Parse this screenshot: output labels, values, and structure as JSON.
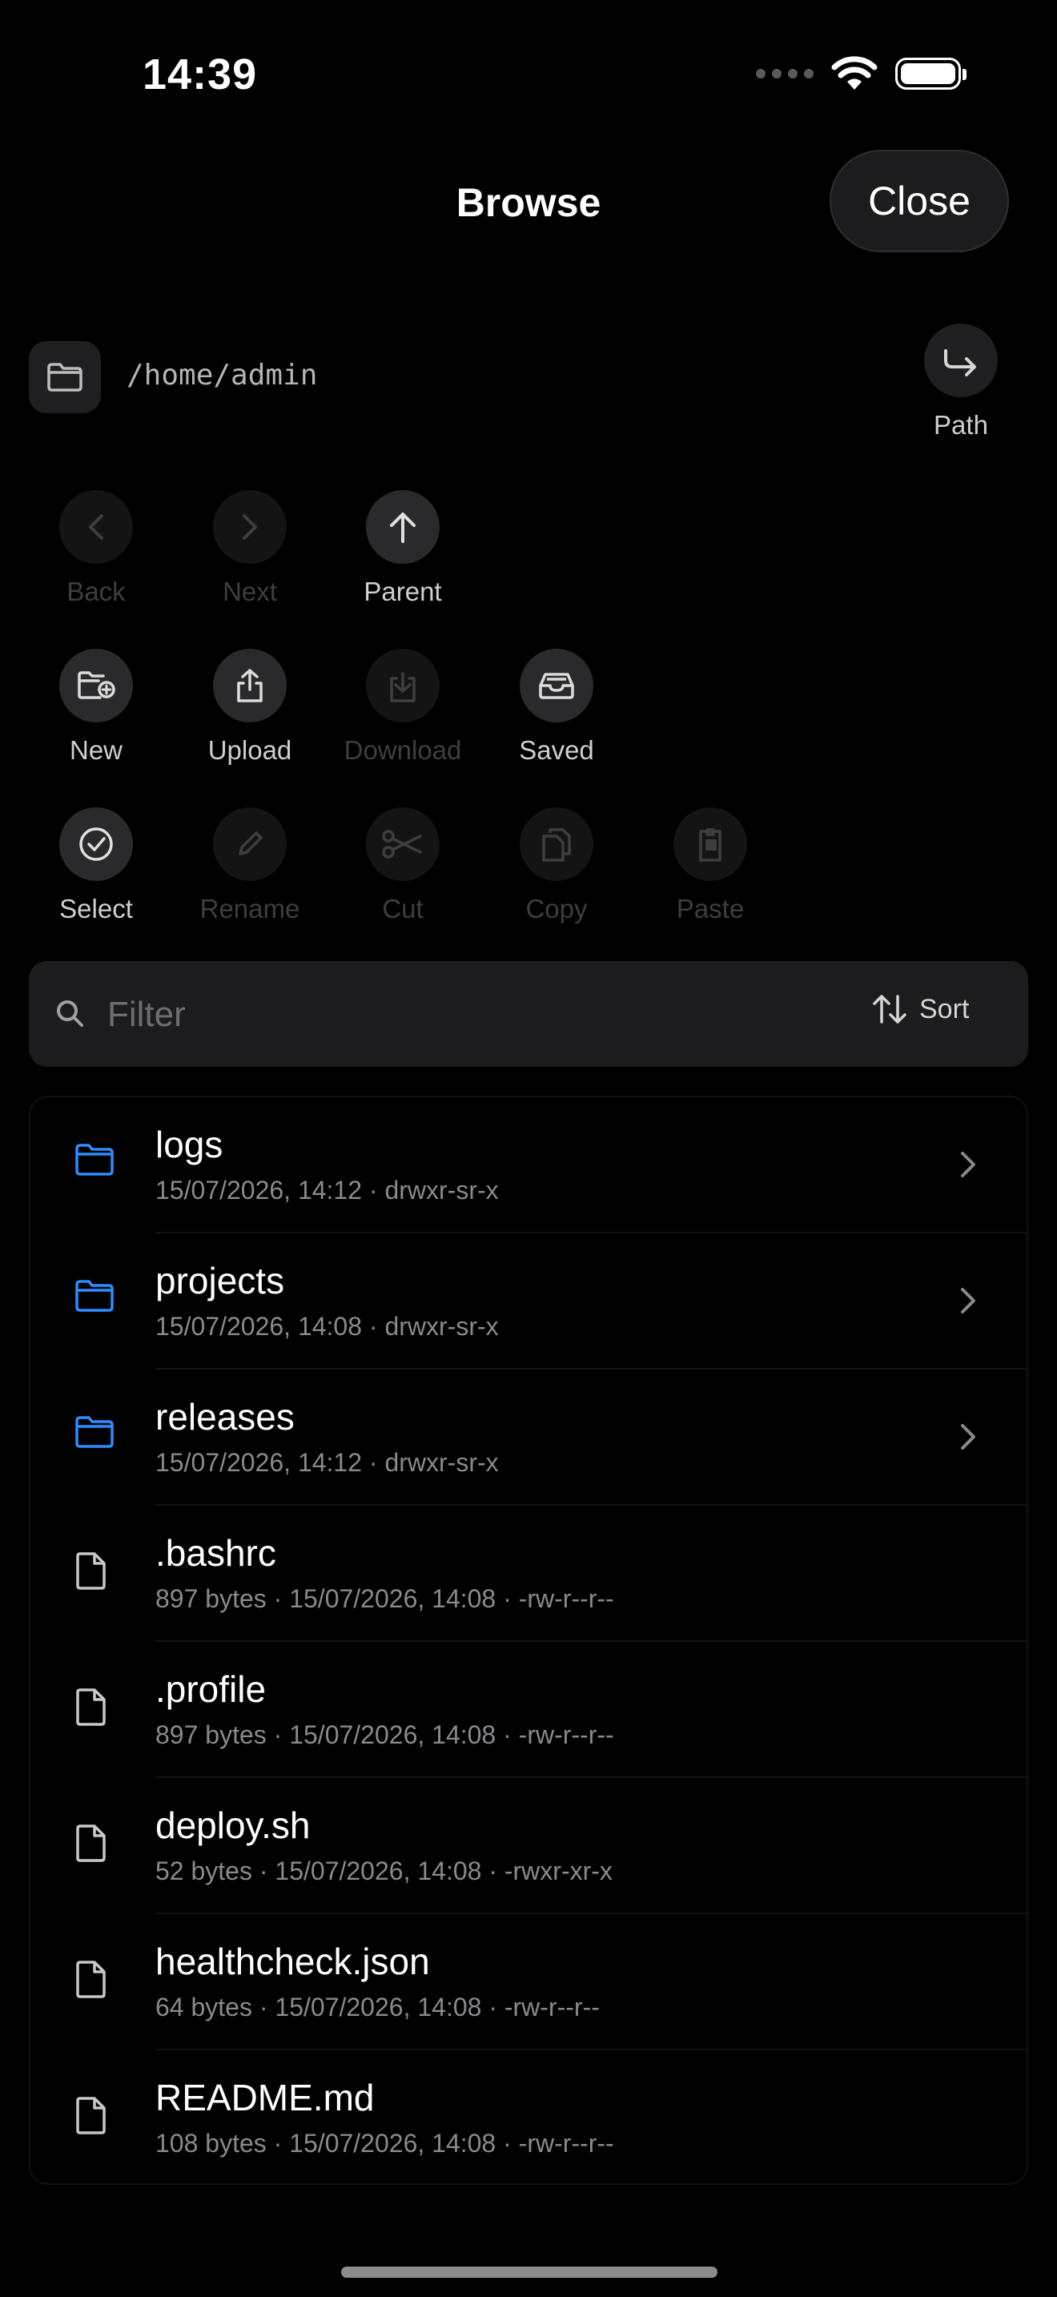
{
  "status": {
    "time": "14:39"
  },
  "header": {
    "title": "Browse",
    "close_label": "Close"
  },
  "path": {
    "value": "/home/admin",
    "button_label": "Path"
  },
  "toolbar": {
    "back": "Back",
    "next": "Next",
    "parent": "Parent",
    "new": "New",
    "upload": "Upload",
    "download": "Download",
    "saved": "Saved",
    "select": "Select",
    "rename": "Rename",
    "cut": "Cut",
    "copy": "Copy",
    "paste": "Paste"
  },
  "filter": {
    "placeholder": "Filter",
    "sort_label": "Sort"
  },
  "files": [
    {
      "name": "logs",
      "meta": "15/07/2026, 14:12 · drwxr-sr-x",
      "type": "folder"
    },
    {
      "name": "projects",
      "meta": "15/07/2026, 14:08 · drwxr-sr-x",
      "type": "folder"
    },
    {
      "name": "releases",
      "meta": "15/07/2026, 14:12 · drwxr-sr-x",
      "type": "folder"
    },
    {
      "name": ".bashrc",
      "meta": "897 bytes · 15/07/2026, 14:08 · -rw-r--r--",
      "type": "file"
    },
    {
      "name": ".profile",
      "meta": "897 bytes · 15/07/2026, 14:08 · -rw-r--r--",
      "type": "file"
    },
    {
      "name": "deploy.sh",
      "meta": "52 bytes · 15/07/2026, 14:08 · -rwxr-xr-x",
      "type": "file"
    },
    {
      "name": "healthcheck.json",
      "meta": "64 bytes · 15/07/2026, 14:08 · -rw-r--r--",
      "type": "file"
    },
    {
      "name": "README.md",
      "meta": "108 bytes · 15/07/2026, 14:08 · -rw-r--r--",
      "type": "file"
    }
  ],
  "colors": {
    "folder": "#2f8cff",
    "background": "#000000",
    "surface": "#1c1c1e"
  }
}
